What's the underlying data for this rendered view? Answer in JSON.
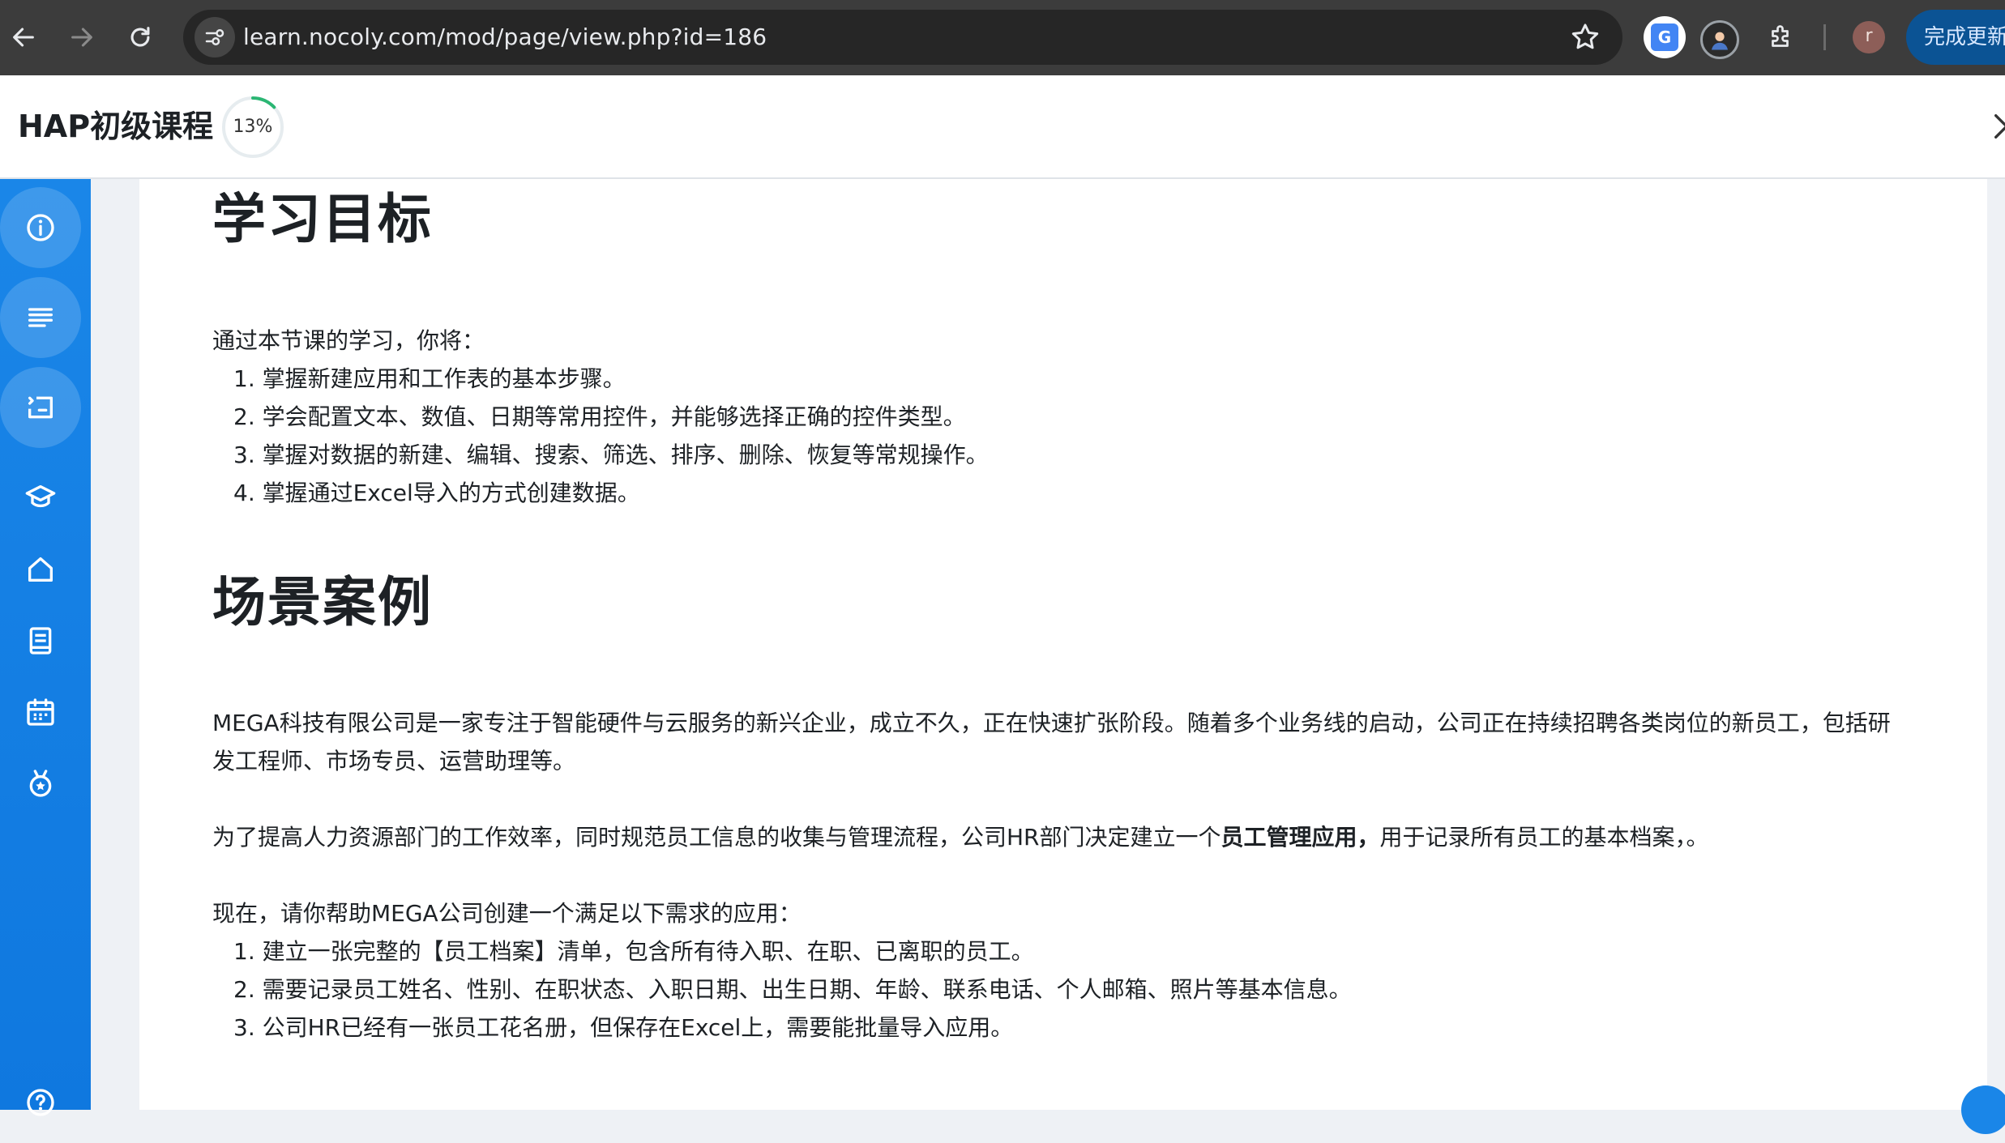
{
  "browser": {
    "url": "learn.nocoly.com/mod/page/view.php?id=186",
    "update_button_label": "完成更新",
    "profile_initial": "r",
    "translate_glyph": "G"
  },
  "course": {
    "title": "HAP初级课程",
    "progress_label": "13%",
    "progress_value": 0.13
  },
  "sidebar": {
    "items": [
      {
        "icon": "info-icon"
      },
      {
        "icon": "list-icon"
      },
      {
        "icon": "activity-icon"
      },
      {
        "icon": "graduation-cap-icon"
      },
      {
        "icon": "home-icon"
      },
      {
        "icon": "book-icon"
      },
      {
        "icon": "calendar-icon"
      },
      {
        "icon": "badge-icon"
      },
      {
        "icon": "help-icon"
      }
    ]
  },
  "content": {
    "goals_heading": "学习目标",
    "goals_intro": "通过本节课的学习，你将：",
    "goals": [
      "1. 掌握新建应用和工作表的基本步骤。",
      "2. 学会配置文本、数值、日期等常用控件，并能够选择正确的控件类型。",
      "3. 掌握对数据的新建、编辑、搜索、筛选、排序、删除、恢复等常规操作。",
      "4. 掌握通过Excel导入的方式创建数据。"
    ],
    "case_heading": "场景案例",
    "case_para1": "MEGA科技有限公司是一家专注于智能硬件与云服务的新兴企业，成立不久，正在快速扩张阶段。随着多个业务线的启动，公司正在持续招聘各类岗位的新员工，包括研发工程师、市场专员、运营助理等。",
    "case_para2_before": "为了提高人力资源部门的工作效率，同时规范员工信息的收集与管理流程，公司HR部门决定建立一个",
    "case_para2_bold": "员工管理应用，",
    "case_para2_after": "用于记录所有员工的基本档案，。",
    "case_para3": "现在，请你帮助MEGA公司创建一个满足以下需求的应用：",
    "requirements": [
      "1. 建立一张完整的【员工档案】清单，包含所有待入职、在职、已离职的员工。",
      "2. 需要记录员工姓名、性别、在职状态、入职日期、出生日期、年龄、联系电话、个人邮箱、照片等基本信息。",
      "3. 公司HR已经有一张员工花名册，但保存在Excel上，需要能批量导入应用。"
    ]
  },
  "colors": {
    "sidebar": "#1a86e8",
    "chrome": "#3c3c3c",
    "progress_ring": "#2bb673"
  }
}
